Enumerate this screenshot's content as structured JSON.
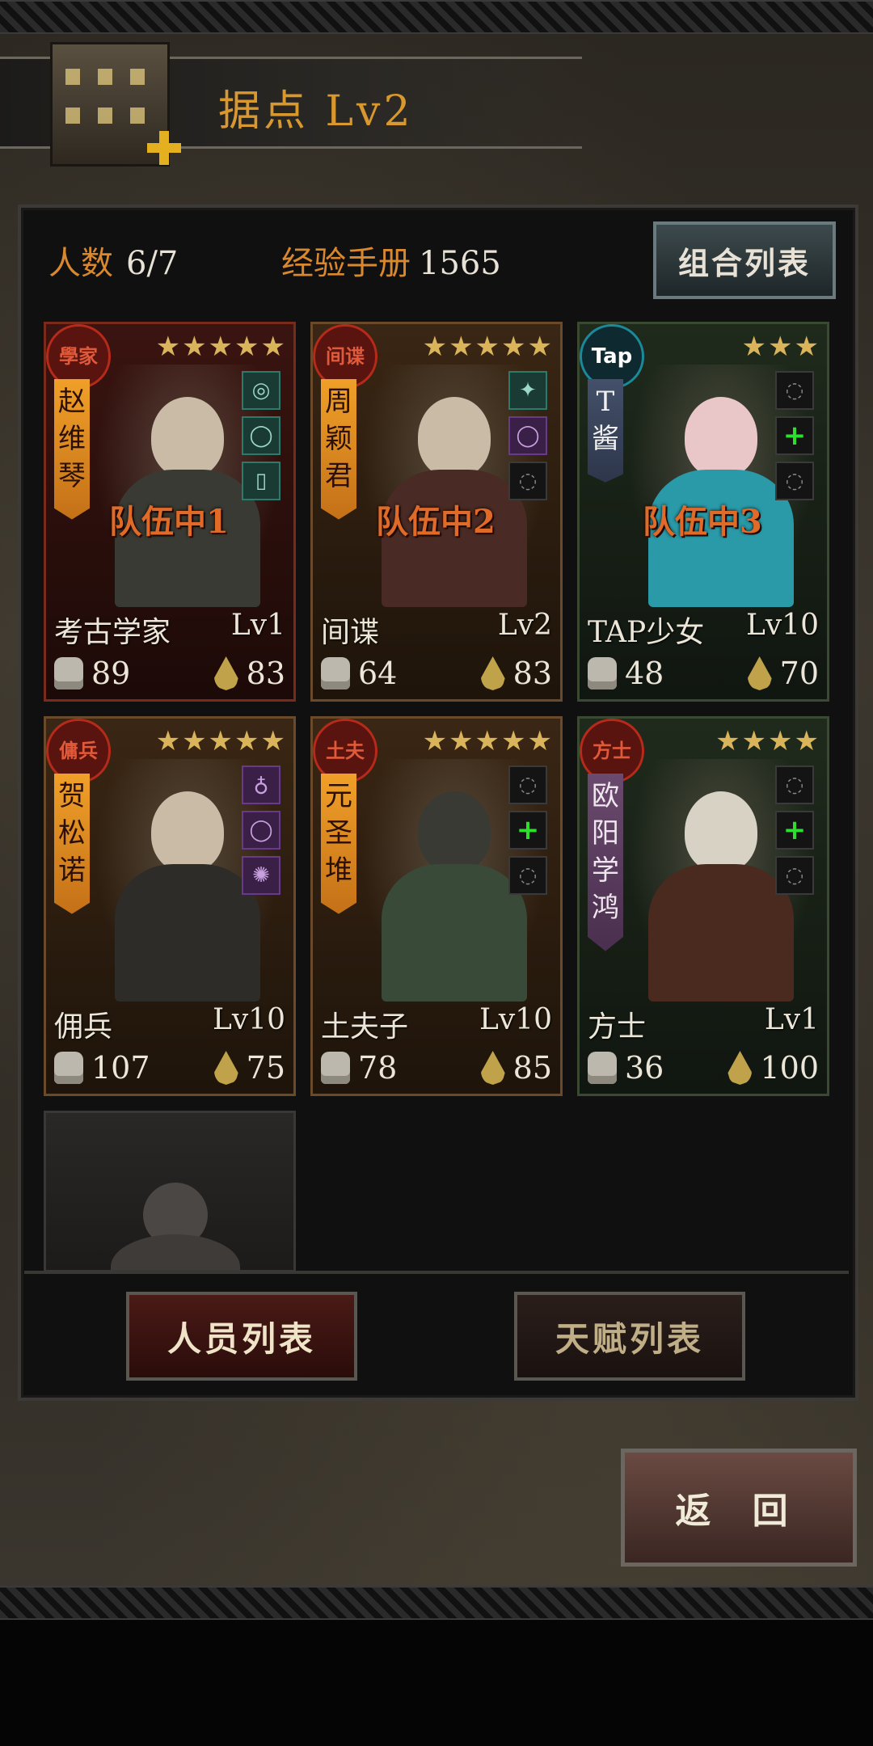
{
  "header": {
    "title": "据点 Lv2"
  },
  "stats": {
    "headcount_label": "人数",
    "headcount_value": "6/7",
    "exp_label": "经验手册",
    "exp_value": "1565"
  },
  "combo_button": "组合列表",
  "characters": [
    {
      "seal": "學家",
      "name_vertical": [
        "赵",
        "维",
        "琴"
      ],
      "stars": "★★★★★",
      "team": "队伍中1",
      "class": "考古学家",
      "level": "Lv1",
      "power": "89",
      "water": "83",
      "equip": [
        "filled",
        "filled",
        "filled"
      ]
    },
    {
      "seal": "间谍",
      "name_vertical": [
        "周",
        "颖",
        "君"
      ],
      "stars": "★★★★★",
      "team": "队伍中2",
      "class": "间谍",
      "level": "Lv2",
      "power": "64",
      "water": "83",
      "equip": [
        "filled",
        "purple",
        "empty"
      ]
    },
    {
      "seal": "Tap",
      "name_vertical": [
        "T",
        "酱"
      ],
      "stars": "★★★",
      "team": "队伍中3",
      "class": "TAP少女",
      "level": "Lv10",
      "power": "48",
      "water": "70",
      "equip": [
        "empty",
        "add",
        "empty"
      ]
    },
    {
      "seal": "傭兵",
      "name_vertical": [
        "贺",
        "松",
        "诺"
      ],
      "stars": "★★★★★",
      "team": "",
      "class": "佣兵",
      "level": "Lv10",
      "power": "107",
      "water": "75",
      "equip": [
        "purple",
        "purple",
        "purple"
      ]
    },
    {
      "seal": "土夫",
      "name_vertical": [
        "元",
        "圣",
        "堆"
      ],
      "stars": "★★★★★",
      "team": "",
      "class": "土夫子",
      "level": "Lv10",
      "power": "78",
      "water": "85",
      "equip": [
        "empty",
        "add",
        "empty"
      ]
    },
    {
      "seal": "方士",
      "name_vertical": [
        "欧",
        "阳",
        "学",
        "鸿"
      ],
      "stars": "★★★★",
      "team": "",
      "class": "方士",
      "level": "Lv1",
      "power": "36",
      "water": "100",
      "equip": [
        "empty",
        "add",
        "empty"
      ]
    }
  ],
  "tabs": {
    "personnel": "人员列表",
    "talents": "天赋列表"
  },
  "back_button": "返 回"
}
